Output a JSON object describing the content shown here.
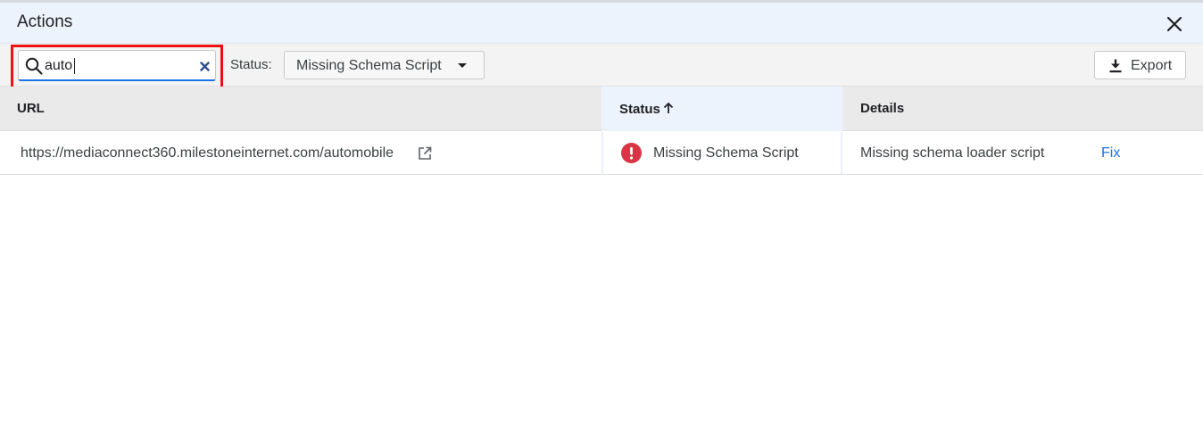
{
  "dialog": {
    "title": "Actions"
  },
  "toolbar": {
    "search": {
      "value": "auto",
      "placeholder": ""
    },
    "status_label": "Status:",
    "status_selected": "Missing Schema Script",
    "export_label": "Export"
  },
  "table": {
    "columns": {
      "url": "URL",
      "status": "Status",
      "details": "Details"
    },
    "sort": {
      "column": "status",
      "direction": "ascending"
    },
    "rows": [
      {
        "url": "https://mediaconnect360.milestoneinternet.com/automobile",
        "status": "Missing Schema Script",
        "details": "Missing schema loader script",
        "action": "Fix"
      }
    ]
  },
  "colors": {
    "header_bg": "#edf3fd",
    "accent": "#1a73e8",
    "error": "#d93645",
    "highlight": "#ee1111"
  },
  "icons": [
    "close-icon",
    "search-icon",
    "clear-icon",
    "chevron-down-icon",
    "download-icon",
    "arrow-up-icon",
    "external-link-icon",
    "error-icon"
  ]
}
